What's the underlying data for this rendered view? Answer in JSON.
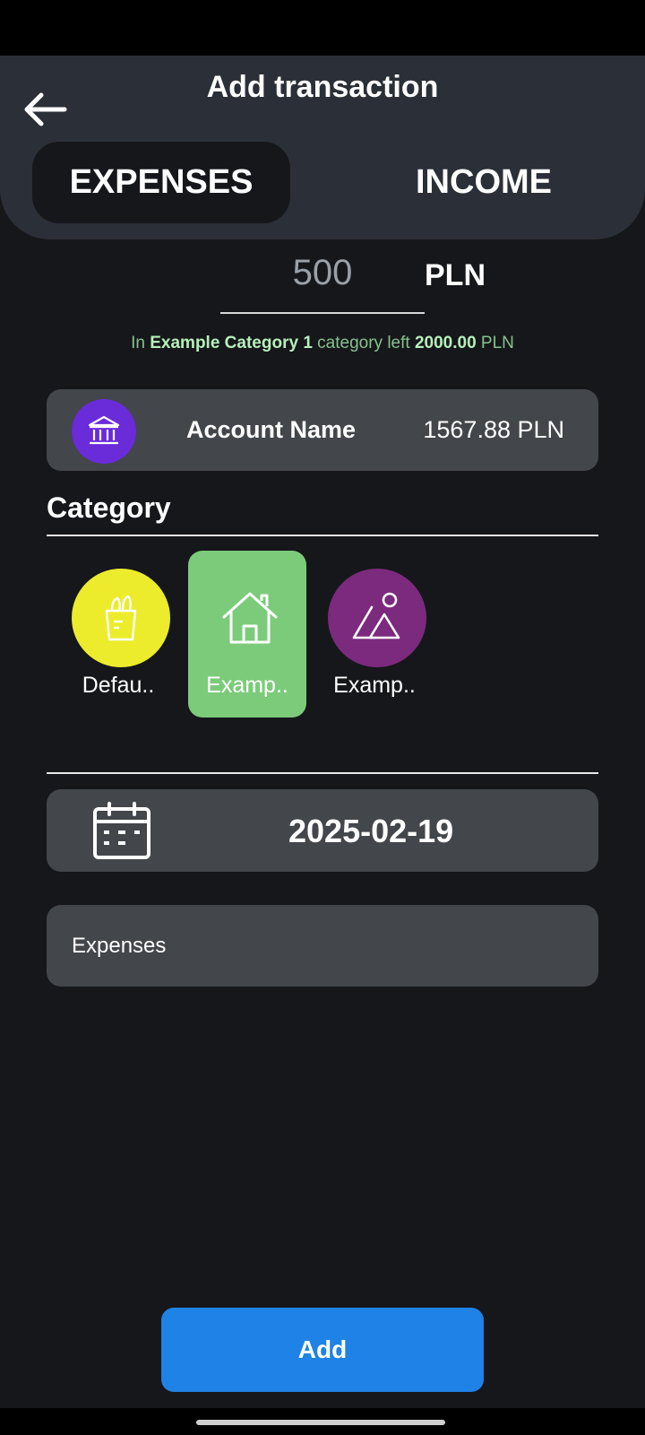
{
  "header": {
    "title": "Add transaction",
    "back_icon": "arrow-left-icon",
    "tabs": [
      {
        "label": "EXPENSES",
        "selected": true
      },
      {
        "label": "INCOME",
        "selected": false
      }
    ]
  },
  "amount": {
    "value": "500",
    "currency": "PLN"
  },
  "budget_info": {
    "prefix": "In",
    "category": "Example Category 1",
    "middle": "category left",
    "amount": "2000.00",
    "suffix": "PLN"
  },
  "account": {
    "icon": "bank-icon",
    "icon_color": "#6a2bd9",
    "name": "Account Name",
    "balance": "1567.88 PLN"
  },
  "category_section": {
    "title": "Category",
    "items": [
      {
        "label": "Defau..",
        "icon": "grocery-bag-icon",
        "color": "#ecec2c",
        "selected": false
      },
      {
        "label": "Examp..",
        "icon": "home-icon",
        "color": "#7ccb7a",
        "selected": true
      },
      {
        "label": "Examp..",
        "icon": "shapes-icon",
        "color": "#7b2a7d",
        "selected": false
      }
    ]
  },
  "date": {
    "icon": "calendar-icon",
    "value": "2025-02-19"
  },
  "note": {
    "value": "Expenses"
  },
  "actions": {
    "add_label": "Add",
    "add_color": "#1e82e6"
  }
}
